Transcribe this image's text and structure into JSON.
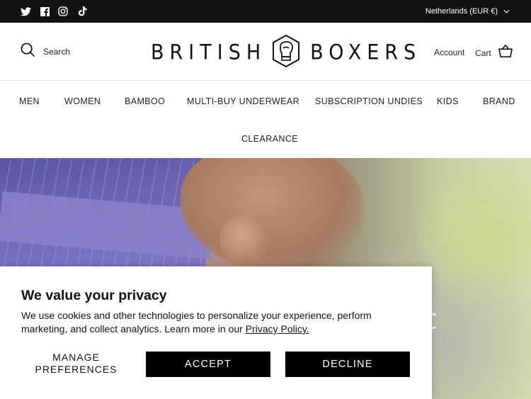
{
  "topbar": {
    "social_icons": [
      "twitter-icon",
      "facebook-icon",
      "instagram-icon",
      "tiktok-icon"
    ],
    "region_label": "Netherlands (EUR €)",
    "region_icon": "chevron-down-icon"
  },
  "header": {
    "search_label": "Search",
    "logo": {
      "left_word": "BRITISH",
      "right_word": "BOXERS",
      "badge_icon": "boxing-glove-icon"
    },
    "account_label": "Account",
    "cart_label": "Cart",
    "cart_icon": "basket-icon"
  },
  "nav": {
    "items": [
      "MEN",
      "WOMEN",
      "BAMBOO",
      "MULTI-BUY UNDERWEAR",
      "SUBSCRIPTION UNDIES",
      "KIDS",
      "BRAND",
      "CLEARANCE"
    ]
  },
  "hero": {
    "partial_text": "c"
  },
  "cookie": {
    "title": "We value your privacy",
    "text": "We use cookies and other technologies to personalize your experience, perform marketing, and collect analytics. Learn more in our ",
    "link_text": "Privacy Policy.",
    "manage_line1": "MANAGE",
    "manage_line2": "PREFERENCES",
    "accept_label": "ACCEPT",
    "decline_label": "DECLINE"
  },
  "colors": {
    "topbar_bg": "#111111",
    "button_bg": "#000000",
    "text": "#111111"
  }
}
